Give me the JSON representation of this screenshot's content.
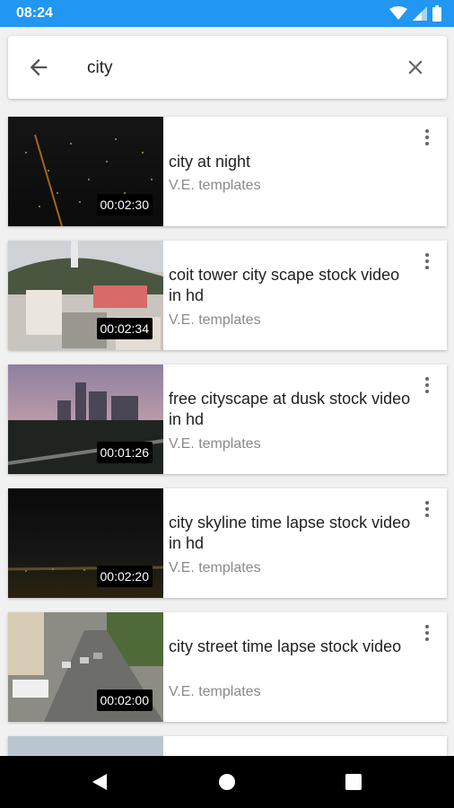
{
  "status_bar": {
    "time": "08:24",
    "icons": [
      "wifi-icon",
      "signal-icon",
      "battery-icon"
    ]
  },
  "search": {
    "query": "city",
    "back_icon": "arrow-left-icon",
    "clear_icon": "close-icon"
  },
  "results": [
    {
      "title": "city at night",
      "channel": "V.E. templates",
      "duration": "00:02:30"
    },
    {
      "title": "coit tower city scape stock video in hd",
      "channel": "V.E. templates",
      "duration": "00:02:34"
    },
    {
      "title": "free cityscape at dusk stock video in hd",
      "channel": "V.E. templates",
      "duration": "00:01:26"
    },
    {
      "title": "city skyline time lapse stock video in hd",
      "channel": "V.E. templates",
      "duration": "00:02:20"
    },
    {
      "title": "city street time lapse stock video",
      "channel": "V.E. templates",
      "duration": "00:02:00"
    }
  ],
  "nav_bar": {
    "icons": [
      "back-triangle-icon",
      "home-circle-icon",
      "recents-square-icon"
    ]
  },
  "colors": {
    "status_bar": "#2196f3",
    "background": "#f1f1f1",
    "title_text": "#222222",
    "channel_text": "#8a8a8a"
  }
}
